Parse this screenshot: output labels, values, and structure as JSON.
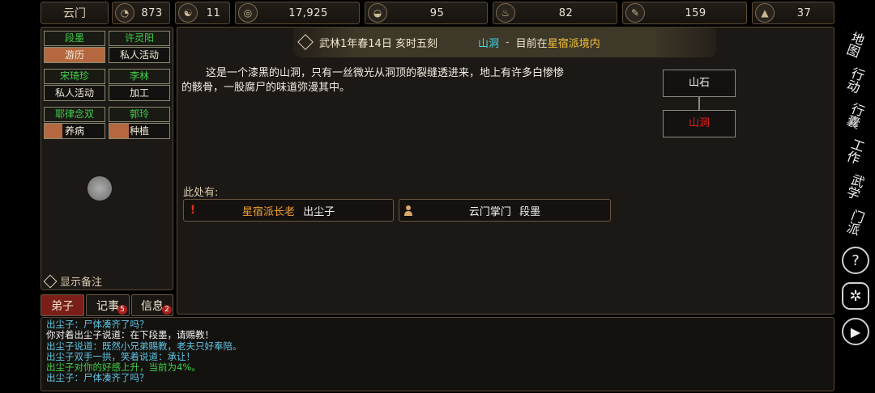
{
  "topbar": {
    "sect": "云门",
    "resources": [
      {
        "icon": "reputation-icon",
        "glyph": "◔",
        "value": "873"
      },
      {
        "icon": "yinyang-icon",
        "glyph": "☯",
        "value": "11"
      },
      {
        "icon": "coin-icon",
        "glyph": "◎",
        "value": "17,925"
      },
      {
        "icon": "food-bowl-icon",
        "glyph": "◒",
        "value": "95"
      },
      {
        "icon": "herb-icon",
        "glyph": "♨",
        "value": "82"
      },
      {
        "icon": "scroll-icon",
        "glyph": "✎",
        "value": "159"
      },
      {
        "icon": "ore-icon",
        "glyph": "▲",
        "value": "37"
      }
    ]
  },
  "disciples": [
    {
      "name": "段墨",
      "task": "游历",
      "progress": 1.0
    },
    {
      "name": "许灵阳",
      "task": "私人活动",
      "progress": 0.0
    },
    {
      "name": "宋琦珍",
      "task": "私人活动",
      "progress": 0.0
    },
    {
      "name": "李林",
      "task": "加工",
      "progress": 0.0
    },
    {
      "name": "耶律念双",
      "task": "养病",
      "progress": 0.3
    },
    {
      "name": "郭玲",
      "task": "种植",
      "progress": 0.33
    }
  ],
  "show_notes": "显示备注",
  "tabs": [
    {
      "label": "弟子",
      "badge": ""
    },
    {
      "label": "记事",
      "badge": "5"
    },
    {
      "label": "信息",
      "badge": "2"
    }
  ],
  "header": {
    "date": "武林1年春14日 亥时五刻",
    "location": "山洞",
    "separator": "-",
    "status_prefix": "目前在",
    "status_place": "星宿派境内",
    "status_suffix": "境内"
  },
  "description": "这是一个漆黑的山洞，只有一丝微光从洞顶的裂缝透进来，地上有许多白惨惨的骸骨，一股腐尸的味道弥漫其中。",
  "minimap": {
    "top": "山石",
    "bottom": "山洞"
  },
  "here_label": "此处有:",
  "npcs": [
    {
      "title": "星宿派长老",
      "name": "出尘子",
      "icon": "quest-alert-icon"
    },
    {
      "title": "云门掌门",
      "name": "段墨",
      "icon": "person-icon"
    }
  ],
  "sidebar": [
    {
      "label": "地图",
      "name": "map-button"
    },
    {
      "label": "行动",
      "name": "action-button"
    },
    {
      "label": "行囊",
      "name": "inventory-button"
    },
    {
      "label": "工作",
      "name": "work-button"
    },
    {
      "label": "武学",
      "name": "martial-arts-button"
    },
    {
      "label": "门派",
      "name": "sect-button"
    }
  ],
  "log": [
    {
      "text": "出尘子：尸体凑齐了吗？",
      "color": "#5fc7e6"
    },
    {
      "text": "你对着出尘子说道：在下段墨，请赐教！",
      "color": "#f2f2f2"
    },
    {
      "text": "出尘子说道：既然小兄弟赐教，老夫只好奉陪。",
      "color": "#5fc7e6"
    },
    {
      "text": "出尘子双手一拱，笑着说道：承让！",
      "color": "#5fc7e6"
    },
    {
      "text": "出尘子对你的好感上升，当前为4%。",
      "color": "#3fd04a"
    },
    {
      "text": "出尘子：尸体凑齐了吗？",
      "color": "#5fc7e6"
    }
  ],
  "colors": {
    "accent_red": "#7a1f18",
    "npc_title": "#f0a030",
    "location_cyan": "#3fd9e8",
    "sect_yellow": "#f2c23a",
    "current_room_red": "#e02020"
  }
}
